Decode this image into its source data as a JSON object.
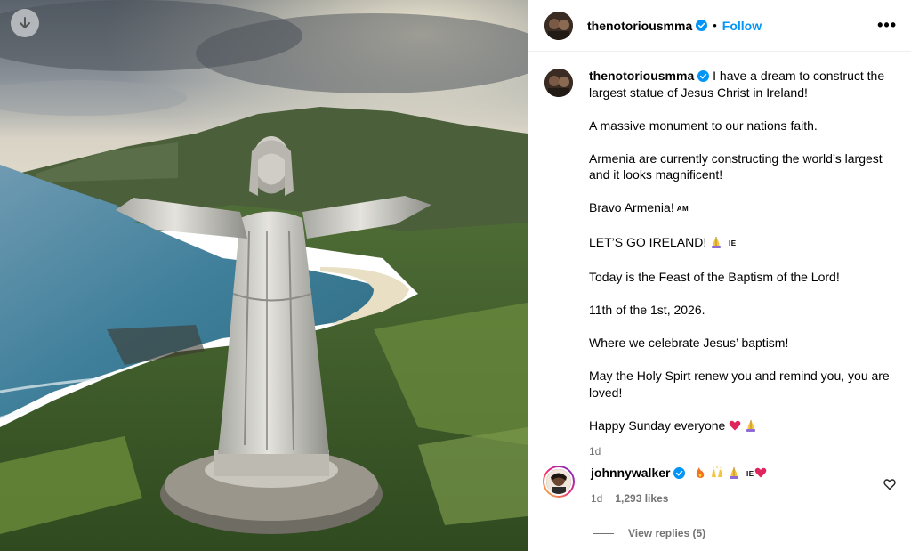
{
  "post": {
    "username": "thenotoriousmma",
    "follow_label": "Follow",
    "separator": "•",
    "more_label": "•••",
    "time": "1d",
    "caption": {
      "first_line": "I have a dream to construct the largest statue of Jesus Christ in Ireland!",
      "paragraphs": [
        "A massive monument to our nations faith.",
        "Armenia are currently constructing the world’s largest and it looks magnificent!",
        "Bravo Armenia!",
        "LET’S GO IRELAND!",
        "Today is the Feast of the Baptism of the Lord!",
        "11th of the 1st, 2026.",
        "Where we celebrate Jesus’ baptism!",
        "May the Holy Spirt renew you and remind you, you are loved!",
        "Happy Sunday everyone"
      ],
      "flag_am": "AM",
      "flag_ie": "IE"
    }
  },
  "comment": {
    "username": "johnnywalker",
    "flag_ie": "IE",
    "time": "1d",
    "likes": "1,293 likes",
    "view_replies": "View replies (5)"
  },
  "icons": {
    "download": "arrow-down-icon",
    "verified": "verified-badge-icon",
    "more": "more-options-icon",
    "like": "heart-outline-icon"
  },
  "colors": {
    "accent": "#0095f6",
    "secondary_text": "#737373",
    "verified": "#0095f6"
  }
}
